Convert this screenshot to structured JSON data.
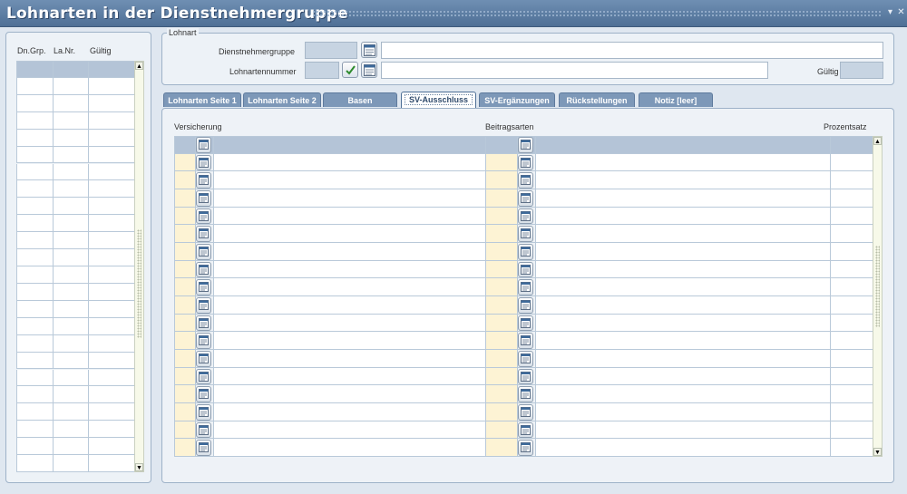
{
  "window": {
    "title": "Lohnarten in der Dienstnehmergruppe",
    "minimize_glyph": "▾",
    "close_glyph": "✕"
  },
  "left_grid": {
    "headers": [
      "Dn.Grp.",
      "La.Nr.",
      "Gültig"
    ],
    "row_count": 24
  },
  "lohnart": {
    "legend": "Lohnart",
    "dienstnehmergruppe_label": "Dienstnehmergruppe",
    "dienstnehmergruppe_code": "",
    "dienstnehmergruppe_name": "",
    "lohnartennummer_label": "Lohnartennummer",
    "lohnartennummer_code": "",
    "lohnartennummer_name": "",
    "gueltig_label": "Gültig",
    "gueltig_value": ""
  },
  "tabs": [
    {
      "label": "Lohnarten Seite 1",
      "active": false
    },
    {
      "label": "Lohnarten Seite 2",
      "active": false
    },
    {
      "label": "Basen",
      "active": false
    },
    {
      "label": "SV-Ausschluss",
      "active": true
    },
    {
      "label": "SV-Ergänzungen",
      "active": false
    },
    {
      "label": "Rückstellungen",
      "active": false
    },
    {
      "label": "Notiz [leer]",
      "active": false
    }
  ],
  "sv_ausschluss": {
    "col_versicherung": "Versicherung",
    "col_beitragsarten": "Beitragsarten",
    "col_prozentsatz": "Prozentsatz",
    "row_count": 18
  },
  "icons": {
    "lookup": "list-lookup-icon",
    "check": "check-icon",
    "scroll_up": "scroll-up-arrow-icon",
    "scroll_down": "scroll-down-arrow-icon"
  },
  "colors": {
    "titlebar": "#5a7aa2",
    "tab_inactive": "#7d98b8",
    "header_row": "#b4c4d7",
    "cream_cell": "#fdf3d4",
    "readonly_field": "#c7d4e2"
  }
}
